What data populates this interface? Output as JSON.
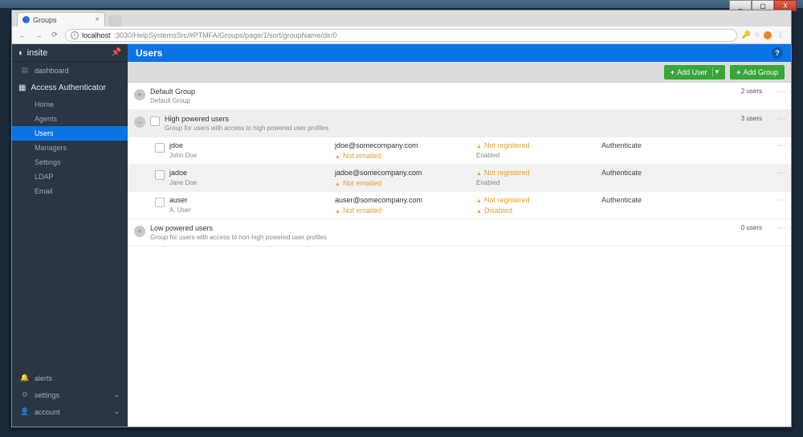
{
  "window": {
    "min": "_",
    "max": "▢",
    "close": "X"
  },
  "browser": {
    "tab_title": "Groups",
    "host": "localhost",
    "port_path": ":3030/HelpSystemsSrc/#PTMFA/Groups/page/1/sort/groupName/dir/0"
  },
  "sidebar": {
    "brand": "insite",
    "dashboard": "dashboard",
    "app_name": "Access Authenticator",
    "items": [
      "Home",
      "Agents",
      "Users",
      "Managers",
      "Settings",
      "LDAP",
      "Email"
    ],
    "bottom": [
      "alerts",
      "settings",
      "account"
    ]
  },
  "header": {
    "title": "Users"
  },
  "toolbar": {
    "add_user": "Add User",
    "add_group": "Add Group"
  },
  "groups": [
    {
      "name": "Default Group",
      "desc": "Default Group",
      "count": "2 users",
      "expanded": false
    },
    {
      "name": "High powered users",
      "desc": "Group for users with access to high powered user profiles",
      "count": "3 users",
      "expanded": true,
      "users": [
        {
          "id": "jdoe",
          "full": "John Doe",
          "email": "jdoe@somecompany.com",
          "email_status": "Not emailed",
          "reg": "Not registered",
          "enabled": "Enabled",
          "auth": "Authenticate"
        },
        {
          "id": "jadoe",
          "full": "Jane Doe",
          "email": "jadoe@somecompany.com",
          "email_status": "Not emailed",
          "reg": "Not registered",
          "enabled": "Enabled",
          "auth": "Authenticate"
        },
        {
          "id": "auser",
          "full": "A. User",
          "email": "auser@somecompany.com",
          "email_status": "Not emailed",
          "reg": "Not registered",
          "enabled": "Disabled",
          "auth": "Authenticate"
        }
      ]
    },
    {
      "name": "Low powered users",
      "desc": "Group for users with access to non-high powered user profiles",
      "count": "0 users",
      "expanded": false
    }
  ]
}
